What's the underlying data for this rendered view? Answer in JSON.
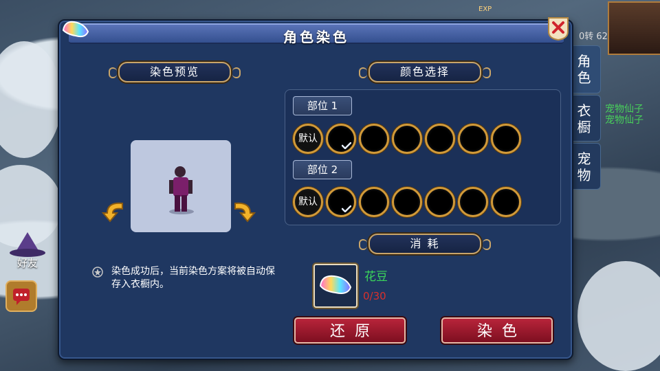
{
  "window": {
    "title": "角色染色"
  },
  "preview": {
    "header": "染色预览"
  },
  "color_select": {
    "header": "颜色选择",
    "parts": [
      {
        "label": "部位 1",
        "default_label": "默认",
        "selected_index": 1
      },
      {
        "label": "部位 2",
        "default_label": "默认",
        "selected_index": 1
      }
    ]
  },
  "consume": {
    "header": "消 耗",
    "item_name": "花豆",
    "item_count": "0/30"
  },
  "note": {
    "text": "染色成功后，当前染色方案将被自动保存入衣橱内。"
  },
  "buttons": {
    "restore": "还原",
    "dye": "染色"
  },
  "side_tabs": [
    "角色",
    "衣橱",
    "宠物"
  ],
  "hud": {
    "friend": "好友",
    "exp": "EXP",
    "pet_names": [
      "宠物仙子",
      "宠物仙子"
    ],
    "level": "0转 62"
  },
  "colors": {
    "panel": "#1f3761",
    "accent_gold": "#d19a3a",
    "button_red": "#b8243a",
    "item_green": "#3bd65a",
    "count_red": "#d9302c"
  }
}
